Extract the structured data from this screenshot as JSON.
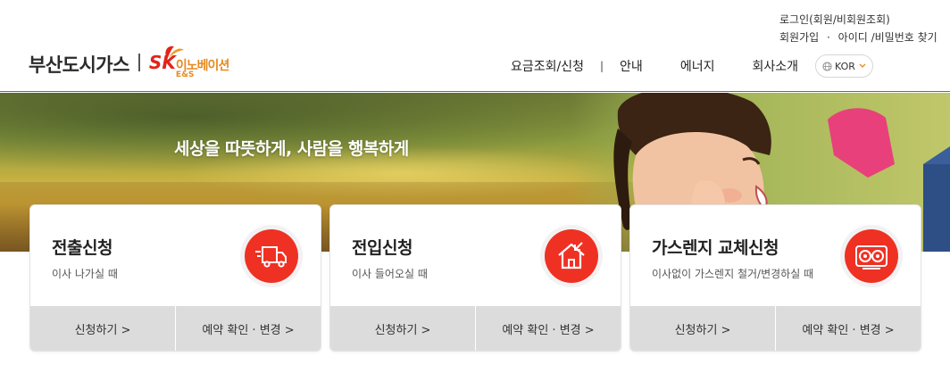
{
  "brand": {
    "name_kr": "부산도시가스",
    "sk": "SK",
    "sub": "이노베이션",
    "ens": "E&S"
  },
  "util": {
    "login": "로그인(회원/비회원조회)",
    "join": "회원가입",
    "dot": "·",
    "find": "아이디 /비밀번호 찾기"
  },
  "gnb": {
    "items": [
      "요금조회/신청",
      "안내",
      "에너지",
      "회사소개"
    ],
    "separator": "|",
    "lang": "KOR"
  },
  "hero": {
    "slogan": "세상을 따뜻하게, 사람을 행복하게"
  },
  "cards": [
    {
      "title": "전출신청",
      "desc": "이사 나가실 때",
      "icon": "moving-truck-icon",
      "apply": "신청하기 >",
      "check": "예약 확인 · 변경 >"
    },
    {
      "title": "전입신청",
      "desc": "이사 들어오실 때",
      "icon": "house-arrow-icon",
      "apply": "신청하기 >",
      "check": "예약 확인 · 변경 >"
    },
    {
      "title": "가스렌지 교체신청",
      "desc": "이사없이 가스렌지 철거/변경하실 때",
      "icon": "gas-range-icon",
      "apply": "신청하기 >",
      "check": "예약 확인 · 변경 >"
    }
  ],
  "colors": {
    "accent": "#ef3124",
    "sk_red": "#e2231a",
    "sk_orange": "#e58a1f",
    "action_bg": "#dcdcdc"
  }
}
